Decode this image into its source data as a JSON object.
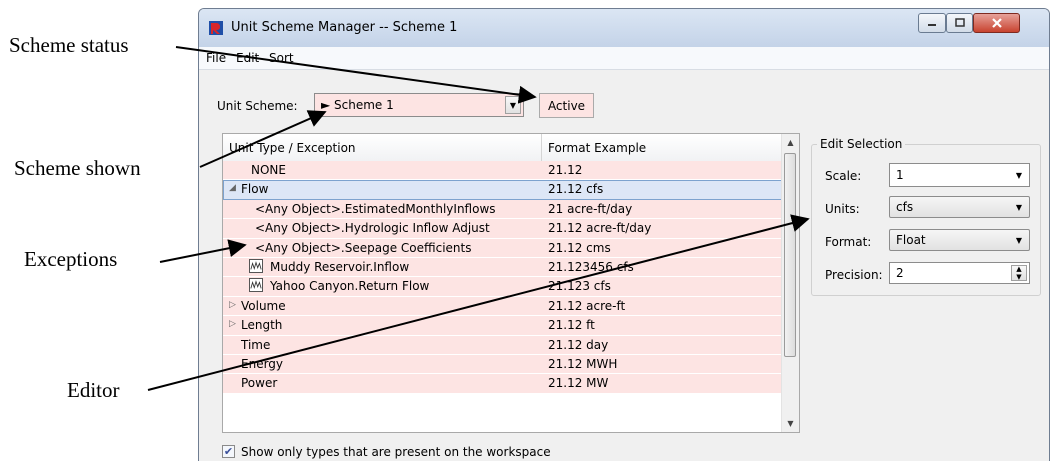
{
  "window": {
    "title": "Unit Scheme Manager -- Scheme 1",
    "controls": [
      "minimize",
      "maximize",
      "close"
    ]
  },
  "menu": {
    "items": [
      "File",
      "Edit",
      "Sort"
    ]
  },
  "scheme": {
    "label": "Unit Scheme:",
    "selected": "► Scheme 1",
    "status": "Active"
  },
  "table": {
    "columns": [
      "Unit Type / Exception",
      "Format Example"
    ],
    "rows": [
      {
        "name": "NONE",
        "example": "21.12",
        "kind": "type"
      },
      {
        "name": "Flow",
        "example": "21.12 cfs",
        "kind": "type-expanded",
        "selected": true
      },
      {
        "name": "<Any Object>.EstimatedMonthlyInflows",
        "example": "21 acre-ft/day",
        "kind": "exception"
      },
      {
        "name": "<Any Object>.Hydrologic Inflow Adjust",
        "example": "21.12 acre-ft/day",
        "kind": "exception"
      },
      {
        "name": "<Any Object>.Seepage Coefficients",
        "example": "21.12 cms",
        "kind": "exception"
      },
      {
        "name": "Muddy Reservoir.Inflow",
        "example": "21.123456 cfs",
        "kind": "slot"
      },
      {
        "name": "Yahoo Canyon.Return Flow",
        "example": "21.123 cfs",
        "kind": "slot"
      },
      {
        "name": "Volume",
        "example": "21.12 acre-ft",
        "kind": "type-collapsed"
      },
      {
        "name": "Length",
        "example": "21.12 ft",
        "kind": "type-collapsed"
      },
      {
        "name": "Time",
        "example": "21.12 day",
        "kind": "type"
      },
      {
        "name": "Energy",
        "example": "21.12 MWH",
        "kind": "type"
      },
      {
        "name": "Power",
        "example": "21.12 MW",
        "kind": "type"
      }
    ]
  },
  "edit_selection": {
    "title": "Edit Selection",
    "scale_label": "Scale:",
    "scale_value": "1",
    "units_label": "Units:",
    "units_value": "cfs",
    "format_label": "Format:",
    "format_value": "Float",
    "precision_label": "Precision:",
    "precision_value": "2"
  },
  "footer": {
    "checkbox_label": "Show only types that are present on the workspace",
    "checkbox_checked": true
  },
  "callouts": {
    "scheme_status": "Scheme status",
    "scheme_shown": "Scheme shown",
    "exceptions": "Exceptions",
    "editor": "Editor"
  },
  "colors": {
    "row_pink": "#fde4e3",
    "selection_blue": "#dde6f6",
    "window_bg": "#f0f0f0"
  }
}
